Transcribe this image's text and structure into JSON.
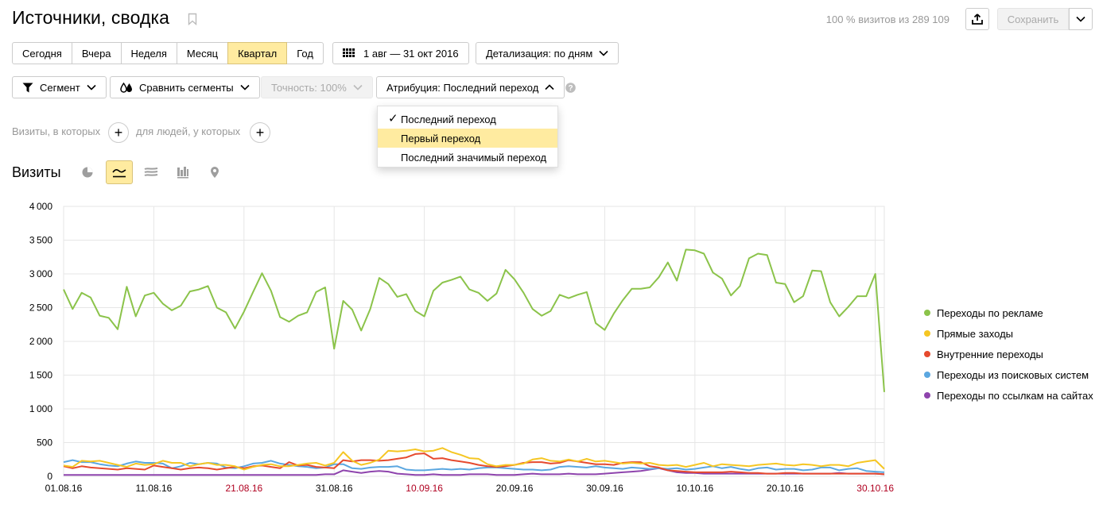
{
  "header": {
    "title": "Источники, сводка",
    "visits_info": "100 % визитов из 289 109",
    "save_label": "Сохранить"
  },
  "period_tabs": [
    "Сегодня",
    "Вчера",
    "Неделя",
    "Месяц",
    "Квартал",
    "Год"
  ],
  "active_period": "Квартал",
  "date_range": "1 авг — 31 окт 2016",
  "detail_label": "Детализация: по дням",
  "toolbar": {
    "segment_label": "Сегмент",
    "compare_label": "Сравнить сегменты",
    "accuracy_label": "Точность: 100%",
    "attribution_label": "Атрибуция: Последний переход"
  },
  "filter": {
    "visits_label": "Визиты, в которых",
    "people_label": "для людей, у которых"
  },
  "attribution_menu": {
    "items": [
      "Последний переход",
      "Первый переход",
      "Последний значимый переход"
    ],
    "selected": "Последний переход",
    "hovered": "Первый переход"
  },
  "section": {
    "title": "Визиты"
  },
  "view_icons": [
    "pie-chart-icon",
    "line-chart-icon",
    "area-chart-icon",
    "bar-chart-icon",
    "map-icon"
  ],
  "colors": {
    "accent": "#ffeba0",
    "weekend_tick": "#b00020"
  },
  "chart_data": {
    "type": "line",
    "ylim": [
      0,
      4000
    ],
    "y_ticks": [
      "0",
      "500",
      "1000",
      "1500",
      "2000",
      "2500",
      "3000",
      "3500",
      "4000"
    ],
    "x_ticks": [
      {
        "label": "01.08.16",
        "day": 0,
        "weekend": false
      },
      {
        "label": "11.08.16",
        "day": 10,
        "weekend": false
      },
      {
        "label": "21.08.16",
        "day": 20,
        "weekend": true
      },
      {
        "label": "31.08.16",
        "day": 30,
        "weekend": false
      },
      {
        "label": "10.09.16",
        "day": 40,
        "weekend": true
      },
      {
        "label": "20.09.16",
        "day": 50,
        "weekend": false
      },
      {
        "label": "30.09.16",
        "day": 60,
        "weekend": false
      },
      {
        "label": "10.10.16",
        "day": 70,
        "weekend": false
      },
      {
        "label": "20.10.16",
        "day": 80,
        "weekend": false
      },
      {
        "label": "30.10.16",
        "day": 90,
        "weekend": true
      }
    ],
    "x_count": 92,
    "series": [
      {
        "name": "Переходы по рекламе",
        "color": "#8bc34a",
        "values": [
          2770,
          2480,
          2720,
          2650,
          2380,
          2350,
          2180,
          2810,
          2370,
          2680,
          2720,
          2560,
          2460,
          2530,
          2740,
          2770,
          2820,
          2500,
          2430,
          2190,
          2440,
          2730,
          3010,
          2750,
          2360,
          2290,
          2380,
          2430,
          2730,
          2800,
          1890,
          2600,
          2470,
          2160,
          2480,
          2940,
          2850,
          2660,
          2700,
          2450,
          2370,
          2750,
          2870,
          2910,
          2960,
          2770,
          2720,
          2600,
          2710,
          3060,
          2920,
          2720,
          2480,
          2380,
          2450,
          2690,
          2640,
          2690,
          2730,
          2270,
          2170,
          2410,
          2610,
          2780,
          2780,
          2800,
          2950,
          3170,
          2900,
          3360,
          3350,
          3300,
          3020,
          2930,
          2680,
          2820,
          3230,
          3300,
          3280,
          2870,
          2850,
          2580,
          2670,
          3050,
          3040,
          2580,
          2370,
          2510,
          2670,
          2670,
          3000,
          1250
        ]
      },
      {
        "name": "Прямые заходы",
        "color": "#f5c623",
        "values": [
          160,
          140,
          230,
          220,
          230,
          200,
          170,
          140,
          190,
          170,
          180,
          230,
          200,
          200,
          150,
          180,
          200,
          170,
          170,
          150,
          100,
          140,
          170,
          180,
          150,
          150,
          170,
          190,
          200,
          160,
          200,
          360,
          230,
          170,
          200,
          250,
          380,
          370,
          380,
          400,
          370,
          380,
          420,
          360,
          320,
          270,
          260,
          180,
          150,
          170,
          170,
          190,
          250,
          270,
          230,
          220,
          250,
          220,
          260,
          220,
          230,
          210,
          190,
          200,
          190,
          200,
          170,
          160,
          170,
          140,
          170,
          200,
          150,
          180,
          170,
          160,
          150,
          170,
          180,
          190,
          170,
          160,
          180,
          170,
          150,
          170,
          170,
          150,
          200,
          220,
          240,
          110
        ]
      },
      {
        "name": "Внутренние переходы",
        "color": "#e64a2e",
        "values": [
          150,
          120,
          150,
          130,
          120,
          110,
          100,
          120,
          110,
          100,
          160,
          140,
          120,
          100,
          120,
          130,
          120,
          100,
          120,
          140,
          120,
          150,
          160,
          140,
          120,
          210,
          160,
          170,
          140,
          130,
          120,
          240,
          220,
          240,
          240,
          230,
          240,
          260,
          280,
          330,
          340,
          260,
          270,
          240,
          220,
          200,
          170,
          150,
          140,
          150,
          170,
          200,
          210,
          210,
          190,
          200,
          240,
          220,
          200,
          180,
          180,
          170,
          200,
          210,
          210,
          150,
          130,
          90,
          80,
          70,
          60,
          60,
          60,
          60,
          70,
          60,
          50,
          50,
          40,
          40,
          50,
          50,
          40,
          40,
          40,
          40,
          40,
          40,
          40,
          40,
          40,
          30
        ]
      },
      {
        "name": "Переходы из поисковых систем",
        "color": "#5ba7e0",
        "values": [
          210,
          240,
          210,
          210,
          180,
          160,
          150,
          190,
          220,
          200,
          200,
          190,
          120,
          150,
          200,
          180,
          200,
          190,
          130,
          120,
          150,
          190,
          200,
          230,
          190,
          170,
          150,
          140,
          120,
          130,
          180,
          180,
          120,
          110,
          130,
          140,
          140,
          150,
          100,
          90,
          90,
          100,
          110,
          100,
          110,
          100,
          120,
          130,
          130,
          120,
          110,
          100,
          100,
          90,
          100,
          140,
          150,
          140,
          130,
          150,
          130,
          120,
          110,
          130,
          120,
          110,
          120,
          110,
          120,
          100,
          110,
          130,
          150,
          120,
          140,
          110,
          90,
          120,
          130,
          100,
          110,
          110,
          90,
          100,
          130,
          130,
          90,
          110,
          120,
          80,
          70,
          60
        ]
      },
      {
        "name": "Переходы по ссылкам на сайтах",
        "color": "#8e44ad",
        "values": [
          20,
          20,
          20,
          20,
          20,
          20,
          20,
          20,
          20,
          20,
          20,
          20,
          20,
          20,
          20,
          20,
          20,
          20,
          20,
          20,
          20,
          20,
          20,
          20,
          20,
          20,
          20,
          20,
          20,
          30,
          30,
          90,
          70,
          50,
          70,
          80,
          70,
          40,
          30,
          20,
          20,
          30,
          20,
          20,
          20,
          30,
          30,
          30,
          20,
          20,
          20,
          30,
          40,
          30,
          30,
          30,
          40,
          30,
          30,
          30,
          40,
          50,
          60,
          70,
          80,
          100,
          120,
          90,
          60,
          50,
          50,
          40,
          40,
          40,
          40,
          40,
          40,
          40,
          40,
          40,
          40,
          40,
          40,
          40,
          40,
          40,
          50,
          40,
          40,
          40,
          40,
          30
        ]
      }
    ]
  }
}
